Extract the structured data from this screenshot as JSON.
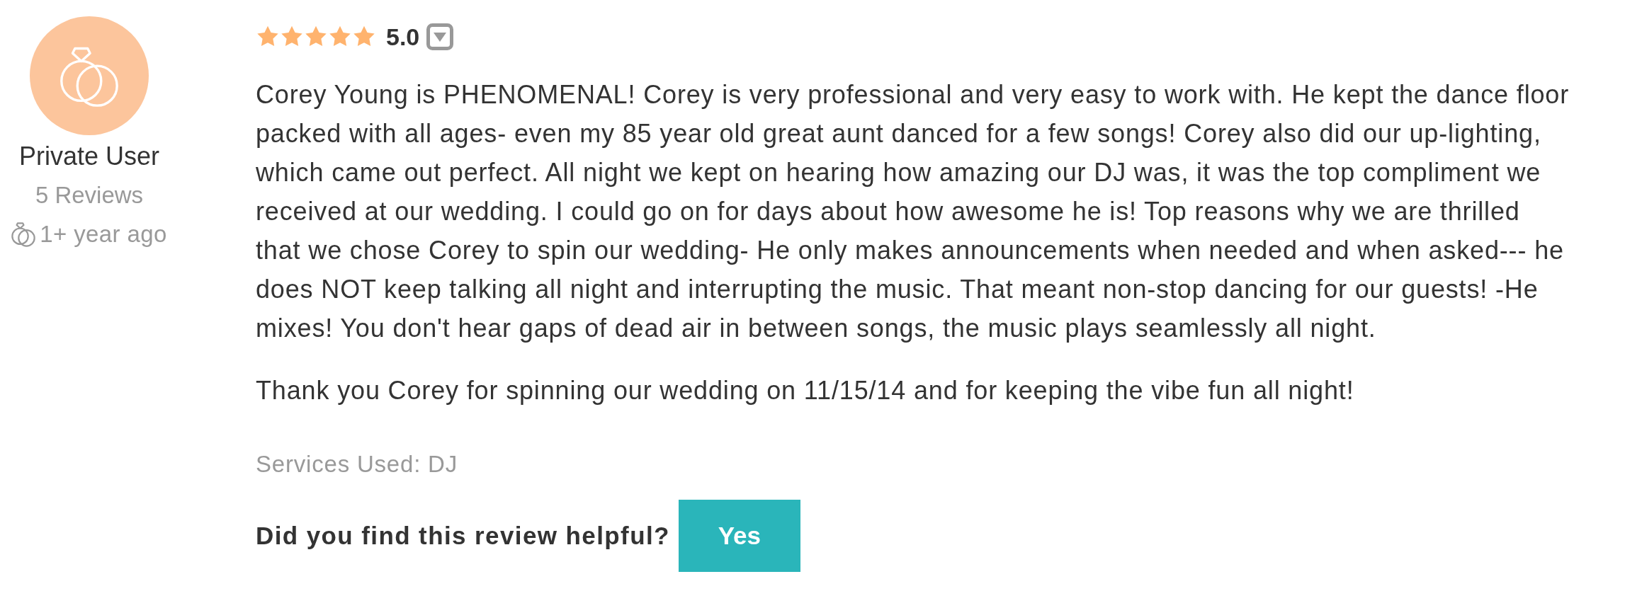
{
  "reviewer": {
    "name": "Private User",
    "review_count": "5 Reviews",
    "time": "1+ year ago"
  },
  "review": {
    "stars": 5,
    "score": "5.0",
    "paragraphs": [
      "Corey Young is PHENOMENAL! Corey is very professional and very easy to work with. He kept the dance floor packed with all ages- even my 85 year old great aunt danced for a few songs! Corey also did our up-lighting, which came out perfect. All night we kept on hearing how amazing our DJ was, it was the top compliment we received at our wedding. I could go on for days about how awesome he is! Top reasons why we are thrilled that we chose Corey to spin our wedding- He only makes announcements when needed and when asked--- he does NOT keep talking all night and interrupting the music. That meant non-stop dancing for our guests! -He mixes! You don't hear gaps of dead air in between songs, the music plays seamlessly all night.",
      "Thank you Corey for spinning our wedding on 11/15/14 and for keeping the vibe fun all night!"
    ],
    "services": "Services Used: DJ"
  },
  "helpful": {
    "question": "Did you find this review helpful?",
    "button": "Yes"
  }
}
